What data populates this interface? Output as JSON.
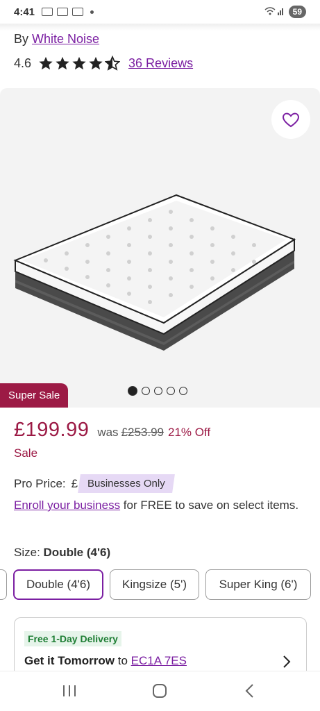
{
  "status_bar": {
    "time": "4:41",
    "battery": "59"
  },
  "product": {
    "brand_prefix": "By",
    "brand": "White Noise",
    "rating": "4.6",
    "rating_stars": 4.6,
    "reviews": "36 Reviews"
  },
  "gallery": {
    "favorite_icon": "heart-icon",
    "image_count": 5,
    "active_index": 0,
    "sale_tag": "Super Sale"
  },
  "pricing": {
    "price": "£199.99",
    "was_label": "was",
    "was_price": "£253.99",
    "discount": "21% Off",
    "sale_label": "Sale",
    "pro_label": "Pro Price:",
    "pro_currency": "£",
    "business_badge": "Businesses Only",
    "enroll_link": "Enroll your business",
    "enroll_text": " for FREE to save on select items."
  },
  "size": {
    "label": "Size:",
    "selected": "Double (4'6)",
    "options": [
      "Double (4'6)",
      "Kingsize (5')",
      "Super King (6')"
    ]
  },
  "delivery": {
    "badge": "Free 1-Day Delivery",
    "headline": "Get it Tomorrow",
    "to": " to ",
    "postcode": "EC1A 7ES"
  },
  "colors": {
    "accent": "#7b1fa2",
    "sale": "#9c1a45",
    "delivery_green": "#1e7e34"
  }
}
